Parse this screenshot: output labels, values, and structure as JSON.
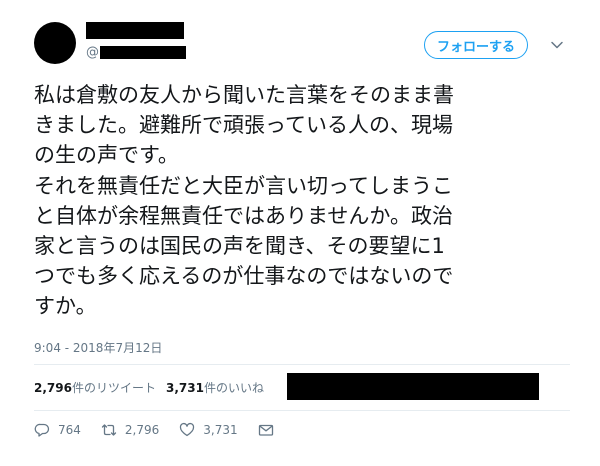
{
  "author": {
    "handle_prefix": "@"
  },
  "header": {
    "follow_label": "フォローする"
  },
  "tweet": {
    "lines": [
      "私は倉敷の友人から聞いた言葉をそのまま書",
      "きました。避難所で頑張っている人の、現場",
      "の生の声です。",
      "それを無責任だと大臣が言い切ってしまうこ",
      "と自体が余程無責任ではありませんか。政治",
      "家と言うのは国民の声を聞き、その要望に1",
      "つでも多く応えるのが仕事なのではないので",
      "すか。"
    ],
    "timestamp": "9:04 - 2018年7月12日"
  },
  "stats": {
    "retweet_count": "2,796",
    "retweet_suffix": "件のリツイート",
    "like_count": "3,731",
    "like_suffix": "件のいいね"
  },
  "actions": {
    "reply_count": "764",
    "retweet_count": "2,796",
    "like_count": "3,731"
  },
  "icons": {
    "reply": "reply-icon",
    "retweet": "retweet-icon",
    "like": "heart-icon",
    "dm": "envelope-icon",
    "more": "chevron-down-icon"
  },
  "colors": {
    "accent": "#1da1f2",
    "muted": "#657786",
    "text": "#14171a",
    "divider": "#e6ecf0"
  }
}
